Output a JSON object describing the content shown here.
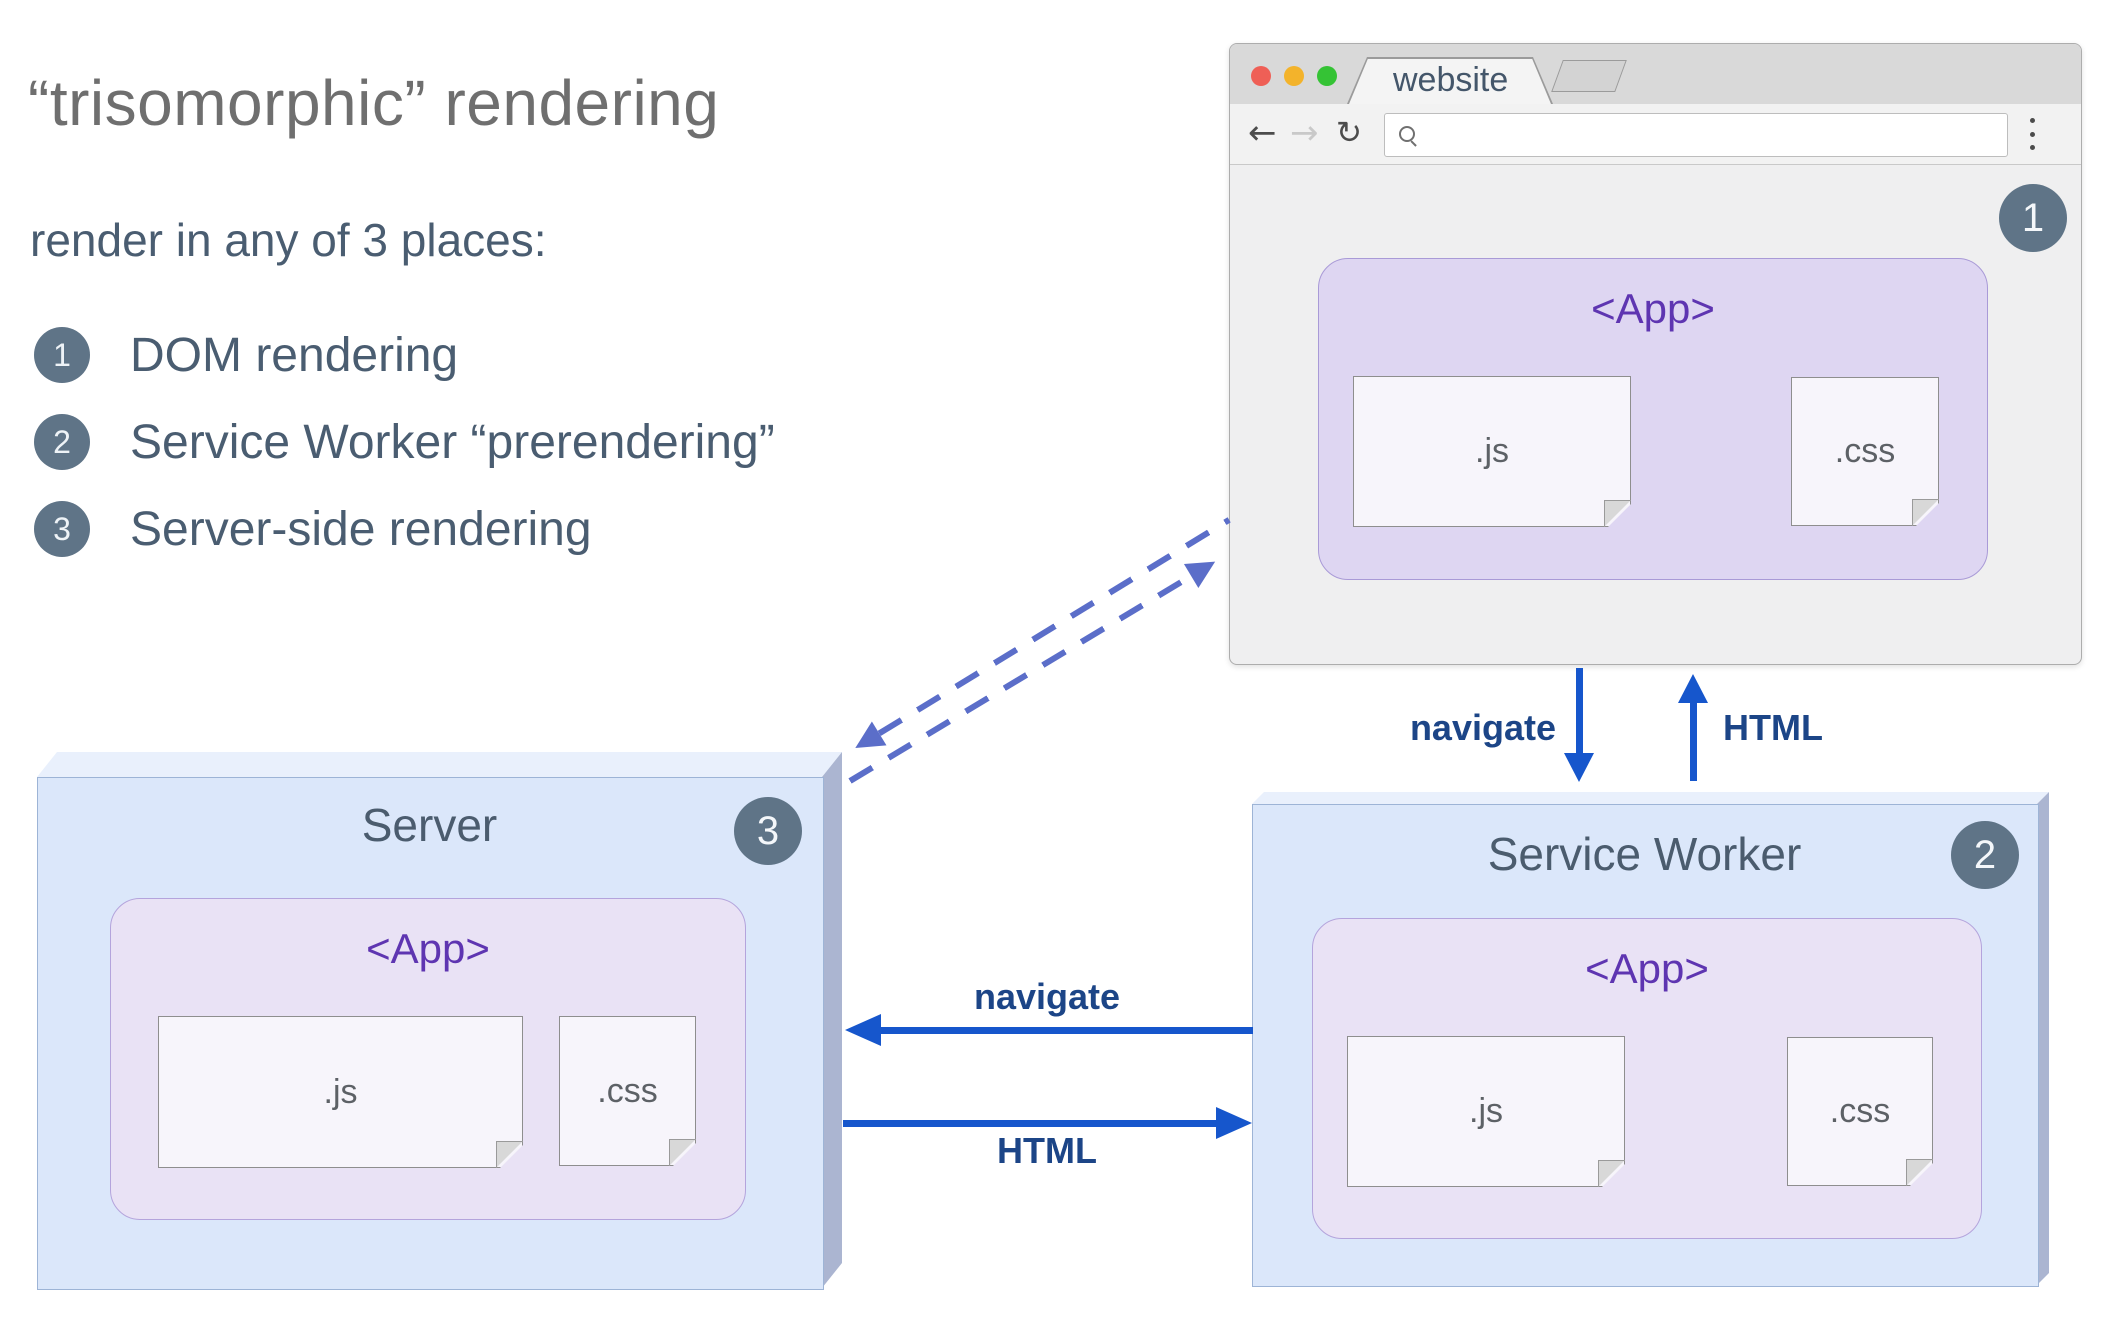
{
  "heading": {
    "title": "“trisomorphic” rendering",
    "subtitle": "render in any of 3 places:",
    "items": [
      {
        "num": "1",
        "label": "DOM rendering"
      },
      {
        "num": "2",
        "label": "Service Worker “prerendering”"
      },
      {
        "num": "3",
        "label": "Server-side rendering"
      }
    ]
  },
  "browser": {
    "tab_title": "website",
    "url_value": "",
    "badge": "1",
    "app": {
      "label": "<App>",
      "js": ".js",
      "css": ".css"
    }
  },
  "server": {
    "title": "Server",
    "badge": "3",
    "app": {
      "label": "<App>",
      "js": ".js",
      "css": ".css"
    }
  },
  "service_worker": {
    "title": "Service Worker",
    "badge": "2",
    "app": {
      "label": "<App>",
      "js": ".js",
      "css": ".css"
    }
  },
  "arrows": {
    "navigate_down": "navigate",
    "html_up": "HTML",
    "navigate_left": "navigate",
    "html_right": "HTML"
  },
  "icons": [
    "back-arrow-icon",
    "forward-arrow-icon",
    "reload-icon",
    "search-icon",
    "overflow-menu-icon",
    "traffic-light-close",
    "traffic-light-minimize",
    "traffic-light-zoom"
  ],
  "colors": {
    "title_gray": "#6f6f6f",
    "slate_text": "#4a5d71",
    "badge_slate": "#5f7487",
    "arrow_blue": "#1656cc",
    "arrow_label_navy": "#1c4587",
    "dashed_periwinkle": "#5b6ec9",
    "box_front": "#dbe7fa",
    "box_top": "#e9f0fc",
    "box_side": "#abb5d1",
    "app_purple_fill": "#ded6f2",
    "app_purple_fill_boxes": "#e9e2f5",
    "app_text_purple": "#5e35b1",
    "chrome_gray": "#d9d9d9"
  }
}
